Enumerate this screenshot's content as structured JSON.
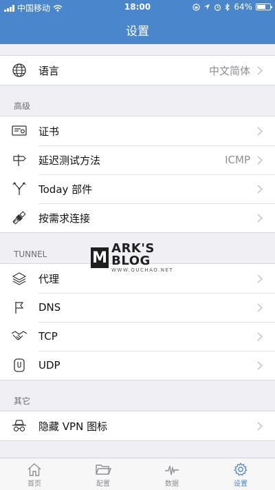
{
  "status": {
    "carrier": "中国移动",
    "time": "18:00",
    "battery": "64%"
  },
  "nav": {
    "title": "设置"
  },
  "language_row": {
    "label": "语言",
    "value": "中文简体"
  },
  "advanced": {
    "header": "高级",
    "items": [
      {
        "label": "证书",
        "value": "",
        "icon": "certificate-icon"
      },
      {
        "label": "延迟测试方法",
        "value": "ICMP",
        "icon": "signpost-icon"
      },
      {
        "label": "Today 部件",
        "value": "",
        "icon": "widget-fork-icon"
      },
      {
        "label": "按需求连接",
        "value": "",
        "icon": "satellite-icon"
      }
    ]
  },
  "tunnel": {
    "header": "TUNNEL",
    "items": [
      {
        "label": "代理",
        "icon": "layers-icon"
      },
      {
        "label": "DNS",
        "icon": "flag-icon"
      },
      {
        "label": "TCP",
        "icon": "handshake-icon"
      },
      {
        "label": "UDP",
        "icon": "udp-icon"
      }
    ]
  },
  "other": {
    "header": "其它",
    "items": [
      {
        "label": "隐藏 VPN 图标",
        "icon": "incognito-icon"
      }
    ]
  },
  "watermark": {
    "letter": "M",
    "title": "ARK'S BLOG",
    "subtitle": "WWW.QUCHAO.NET"
  },
  "tabs": [
    {
      "label": "首页",
      "icon": "home-icon",
      "active": false
    },
    {
      "label": "配置",
      "icon": "folder-icon",
      "active": false
    },
    {
      "label": "数据",
      "icon": "activity-icon",
      "active": false
    },
    {
      "label": "设置",
      "icon": "gear-icon",
      "active": true
    }
  ],
  "colors": {
    "accent": "#4a86cc",
    "background": "#efeff4"
  }
}
